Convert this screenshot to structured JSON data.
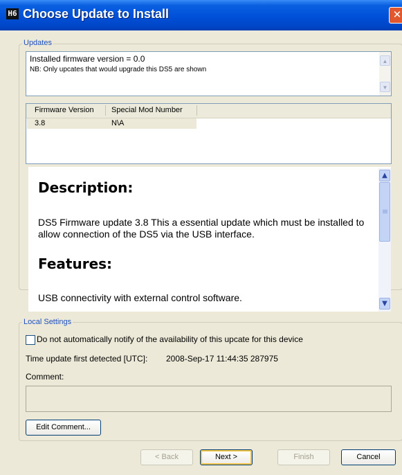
{
  "window": {
    "title": "Choose Update to Install",
    "app_icon_glyph": "H6",
    "close_glyph": "✕"
  },
  "updates_group": {
    "label": "Updates",
    "info_line1": "Installed firmware version = 0.0",
    "info_line2": "NB: Only upcates that would upgrade this DS5 are shown",
    "table": {
      "columns": [
        "Firmware Version",
        "Special Mod Number"
      ],
      "rows": [
        [
          "3.8",
          "N\\A"
        ]
      ]
    }
  },
  "description": {
    "heading1": "Description:",
    "body1": "DS5 Firmware update 3.8 This a essential update which must be installed to allow connection of the DS5 via the USB interface.",
    "heading2": "Features:",
    "body2": "USB connectivity with external control software."
  },
  "local_settings": {
    "label": "Local Settings",
    "checkbox_label": "Do not automatically notify of the availability of this upcate for this device",
    "checkbox_checked": false,
    "time_label": "Time update first detected [UTC]:",
    "time_value": "2008-Sep-17 11:44:35 287975",
    "comment_label": "Comment:",
    "comment_value": "",
    "edit_comment_label": "Edit Comment..."
  },
  "buttons": {
    "back": "< Back",
    "next": "Next >",
    "finish": "Finish",
    "cancel": "Cancel"
  },
  "icons": {
    "app": "app-logo-icon",
    "close": "close-icon",
    "scroll_up": "scroll-up-arrow-icon",
    "scroll_down": "scroll-down-arrow-icon"
  },
  "colors": {
    "titlebar": "#0054e3",
    "close_button": "#e2582e",
    "group_label": "#1c4fc0",
    "window_bg": "#ece9d8"
  }
}
